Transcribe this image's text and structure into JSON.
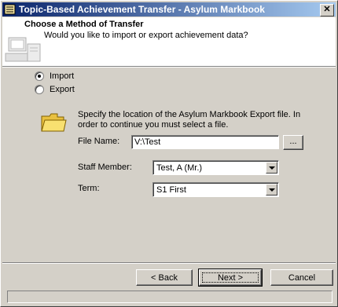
{
  "window": {
    "title": "Topic-Based Achievement Transfer - Asylum Markbook",
    "close_label": "✕"
  },
  "header": {
    "title": "Choose a Method of Transfer",
    "subtitle": "Would you like to import or export achievement data?"
  },
  "mode": {
    "options": [
      {
        "label": "Import",
        "selected": true
      },
      {
        "label": "Export",
        "selected": false
      }
    ]
  },
  "form": {
    "info": "Specify the location of the Asylum Markbook Export file. In order to continue you must select a file.",
    "file_name_label": "File Name:",
    "file_name_value": "V:\\Test",
    "browse_label": "...",
    "staff_label": "Staff Member:",
    "staff_value": "Test, A (Mr.)",
    "term_label": "Term:",
    "term_value": "S1 First"
  },
  "buttons": {
    "back": "< Back",
    "next": "Next >",
    "cancel": "Cancel"
  }
}
